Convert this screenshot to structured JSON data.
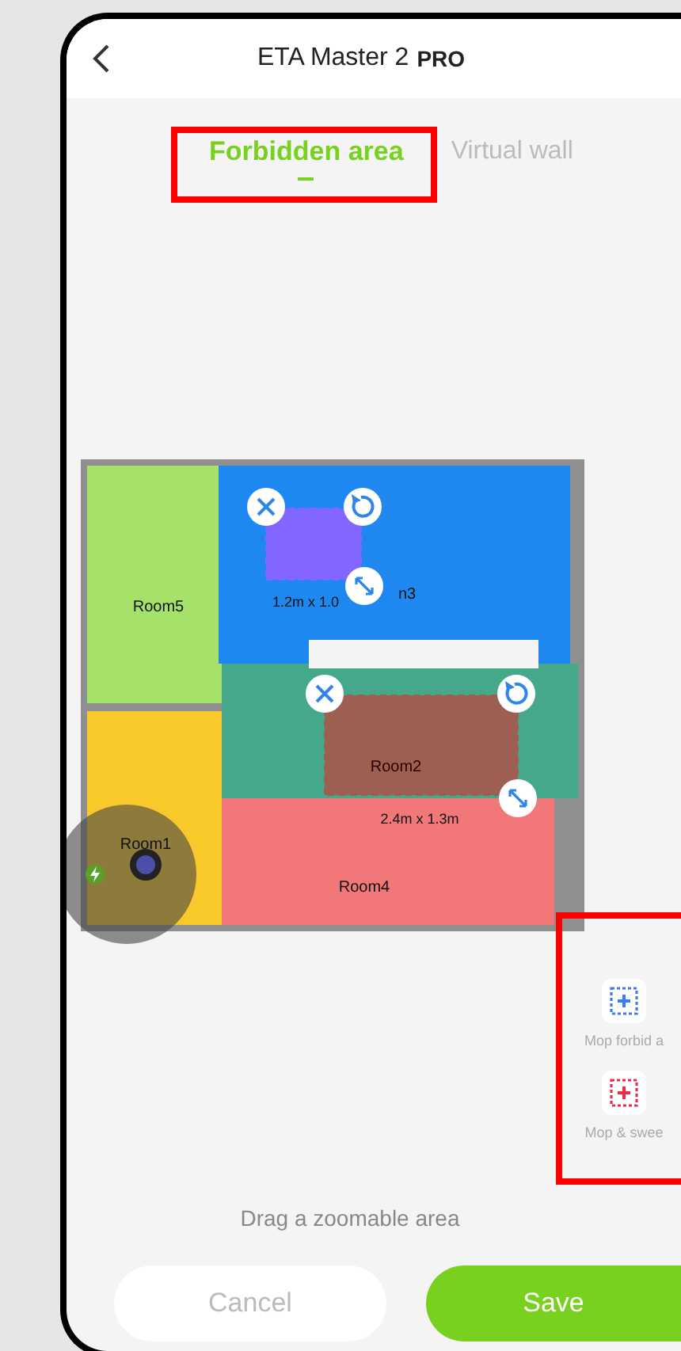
{
  "header": {
    "title": "ETA Master 2",
    "badge": "PRO"
  },
  "tabs": [
    {
      "label": "Forbidden area",
      "selected": true
    },
    {
      "label": "Virtual wall",
      "selected": false
    }
  ],
  "map": {
    "rooms": [
      {
        "label": "Room5",
        "color": "#a6e26a"
      },
      {
        "label": "n3",
        "color": "#1e88f0"
      },
      {
        "label": "Room2",
        "color": "#46a88a"
      },
      {
        "label": "Room1",
        "color": "#f9c92c"
      },
      {
        "label": "Room4",
        "color": "#f27779"
      }
    ],
    "zones": [
      {
        "dimensions": "1.2m x 1.0",
        "color": "#8366ff"
      },
      {
        "dimensions": "2.4m x 1.3m",
        "color": "#9c5f52"
      }
    ]
  },
  "tools": [
    {
      "label": "Mop forbid a",
      "kind": "mop"
    },
    {
      "label": "Mop & swee",
      "kind": "sweep"
    }
  ],
  "hint": "Drag a zoomable area",
  "buttons": [
    {
      "label": "Cancel",
      "kind": "cancel"
    },
    {
      "label": "Save",
      "kind": "save"
    }
  ]
}
